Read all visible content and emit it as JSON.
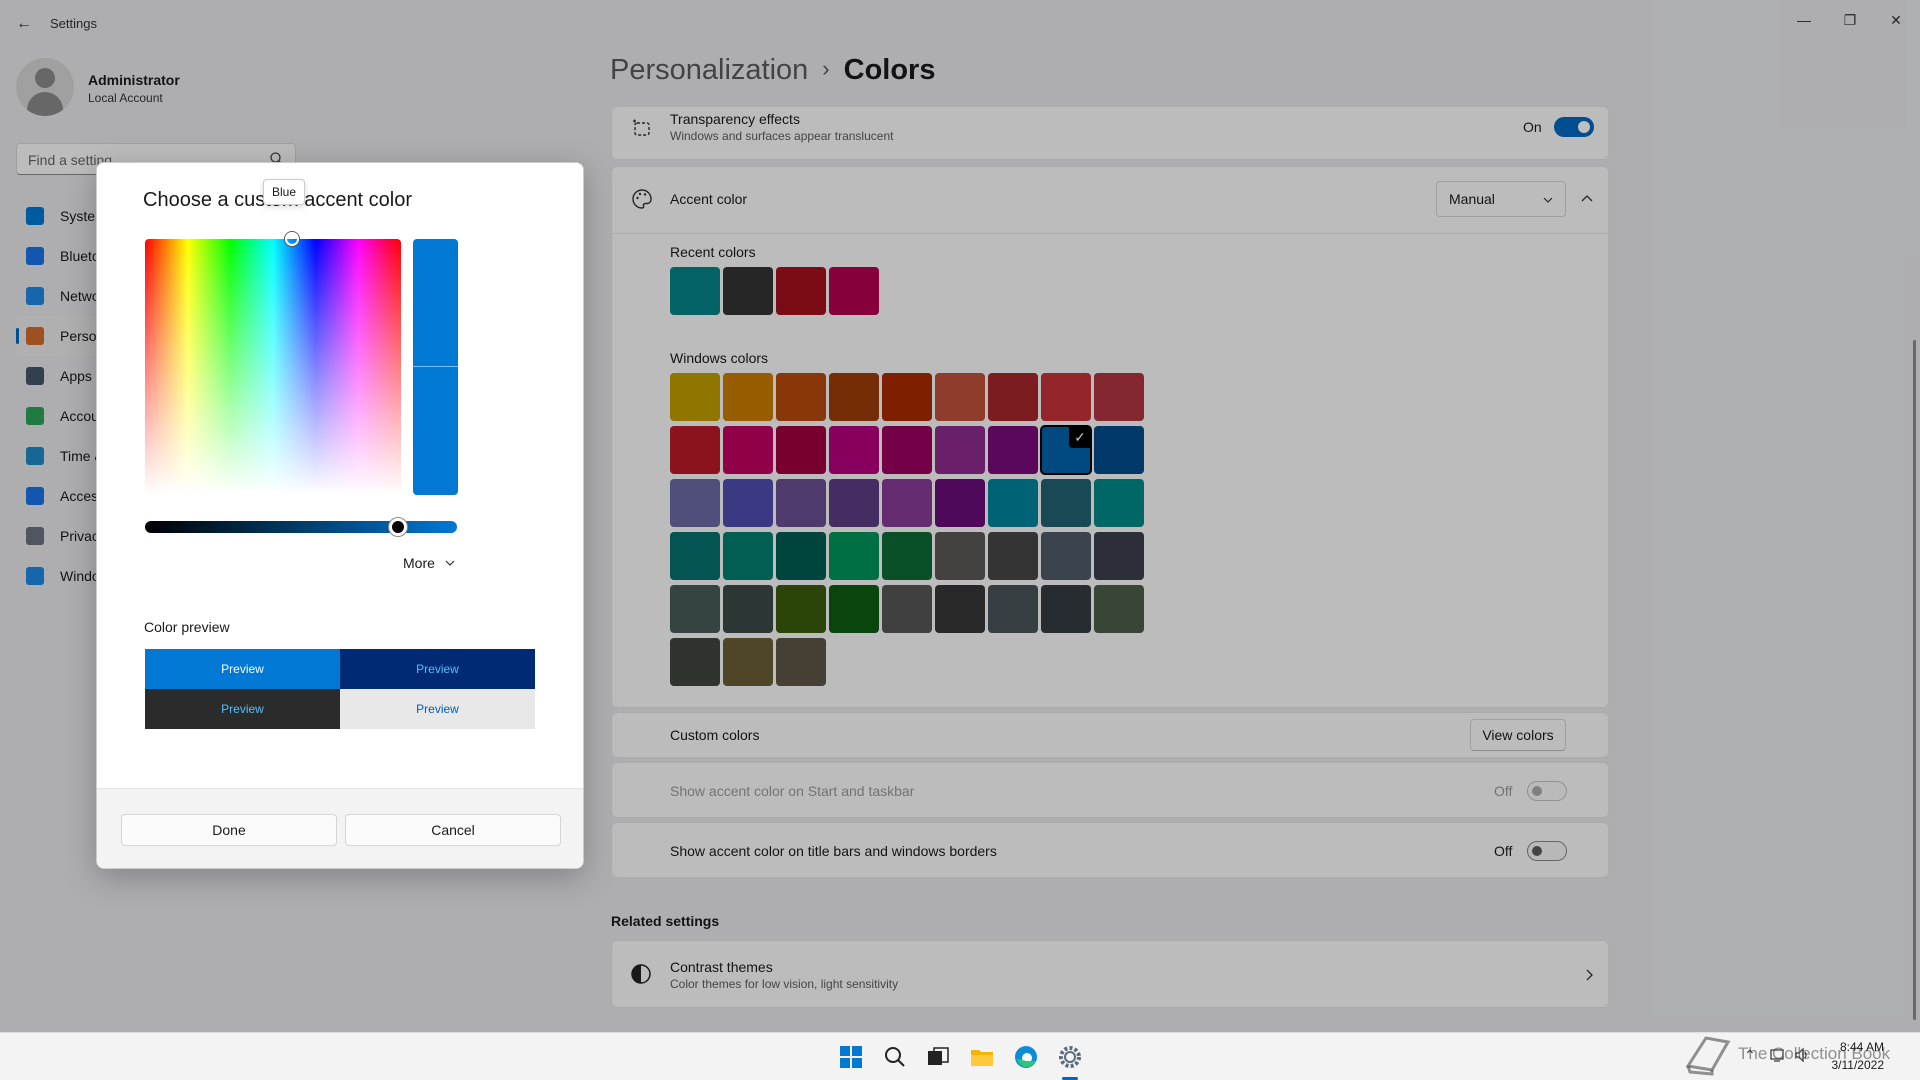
{
  "window": {
    "title": "Settings",
    "minimize": "—",
    "restore": "❐",
    "close": "✕"
  },
  "profile": {
    "name": "Administrator",
    "subtitle": "Local Account"
  },
  "search": {
    "placeholder": "Find a setting"
  },
  "sidebar": {
    "items": [
      {
        "label": "System",
        "color": "#0078d4"
      },
      {
        "label": "Bluetooth & devices",
        "color": "#1a73e8"
      },
      {
        "label": "Network & internet",
        "color": "#1e88e5"
      },
      {
        "label": "Personalization",
        "color": "#d26c2b"
      },
      {
        "label": "Apps",
        "color": "#44546a"
      },
      {
        "label": "Accounts",
        "color": "#2ea35a"
      },
      {
        "label": "Time & language",
        "color": "#1e88c8"
      },
      {
        "label": "Accessibility",
        "color": "#1a73e8"
      },
      {
        "label": "Privacy & security",
        "color": "#6b7280"
      },
      {
        "label": "Windows Update",
        "color": "#1e88e5"
      }
    ]
  },
  "breadcrumb": {
    "parent": "Personalization",
    "separator": "›",
    "current": "Colors"
  },
  "transparency": {
    "title": "Transparency effects",
    "subtitle": "Windows and surfaces appear translucent",
    "state": "On"
  },
  "accent": {
    "title": "Accent color",
    "mode": "Manual",
    "recent_label": "Recent colors",
    "recent_colors": [
      "#038387",
      "#333333",
      "#a4101e",
      "#b3004f"
    ],
    "windows_label": "Windows colors",
    "windows_colors": [
      "#c19c00",
      "#ca7a00",
      "#b7480b",
      "#9d3d0a",
      "#a82a00",
      "#c0513d",
      "#a4262c",
      "#c4323a",
      "#b13440",
      "#b81a28",
      "#bf0062",
      "#a1003f",
      "#b5007e",
      "#9b0060",
      "#8c2a8c",
      "#7a0a7b",
      "#0062ad",
      "#004d8c",
      "#6b69a3",
      "#4f4daf",
      "#684e91",
      "#5c3c86",
      "#873b99",
      "#6a0c78",
      "#00849c",
      "#236273",
      "#028888",
      "#04706f",
      "#027e6e",
      "#015c52",
      "#00955b",
      "#0c6a35",
      "#5b5757",
      "#474646",
      "#4f5a6a",
      "#3c3f4b",
      "#475a57",
      "#3b4947",
      "#3a5c0c",
      "#0c5d10",
      "#565656",
      "#363636",
      "#4a5359",
      "#353b40",
      "#4b5e48",
      "#3e453d",
      "#6a5c34",
      "#5c5546"
    ],
    "selected_index": 16,
    "check_glyph": "✓"
  },
  "custom_colors": {
    "label": "Custom colors",
    "button": "View colors"
  },
  "start_taskbar": {
    "label": "Show accent color on Start and taskbar",
    "state": "Off"
  },
  "title_bars": {
    "label": "Show accent color on title bars and windows borders",
    "state": "Off"
  },
  "related": {
    "heading": "Related settings",
    "title": "Contrast themes",
    "subtitle": "Color themes for low vision, light sensitivity"
  },
  "dialog": {
    "title": "Choose a custom accent color",
    "tooltip": "Blue",
    "current_color": "#0078d4",
    "value_level": 0.81,
    "more_label": "More",
    "preview_label": "Color preview",
    "preview_text": "Preview",
    "done": "Done",
    "cancel": "Cancel"
  },
  "tray": {
    "time": "8:44 AM",
    "date": "3/11/2022"
  },
  "watermark": {
    "text": "The Collection Book"
  }
}
